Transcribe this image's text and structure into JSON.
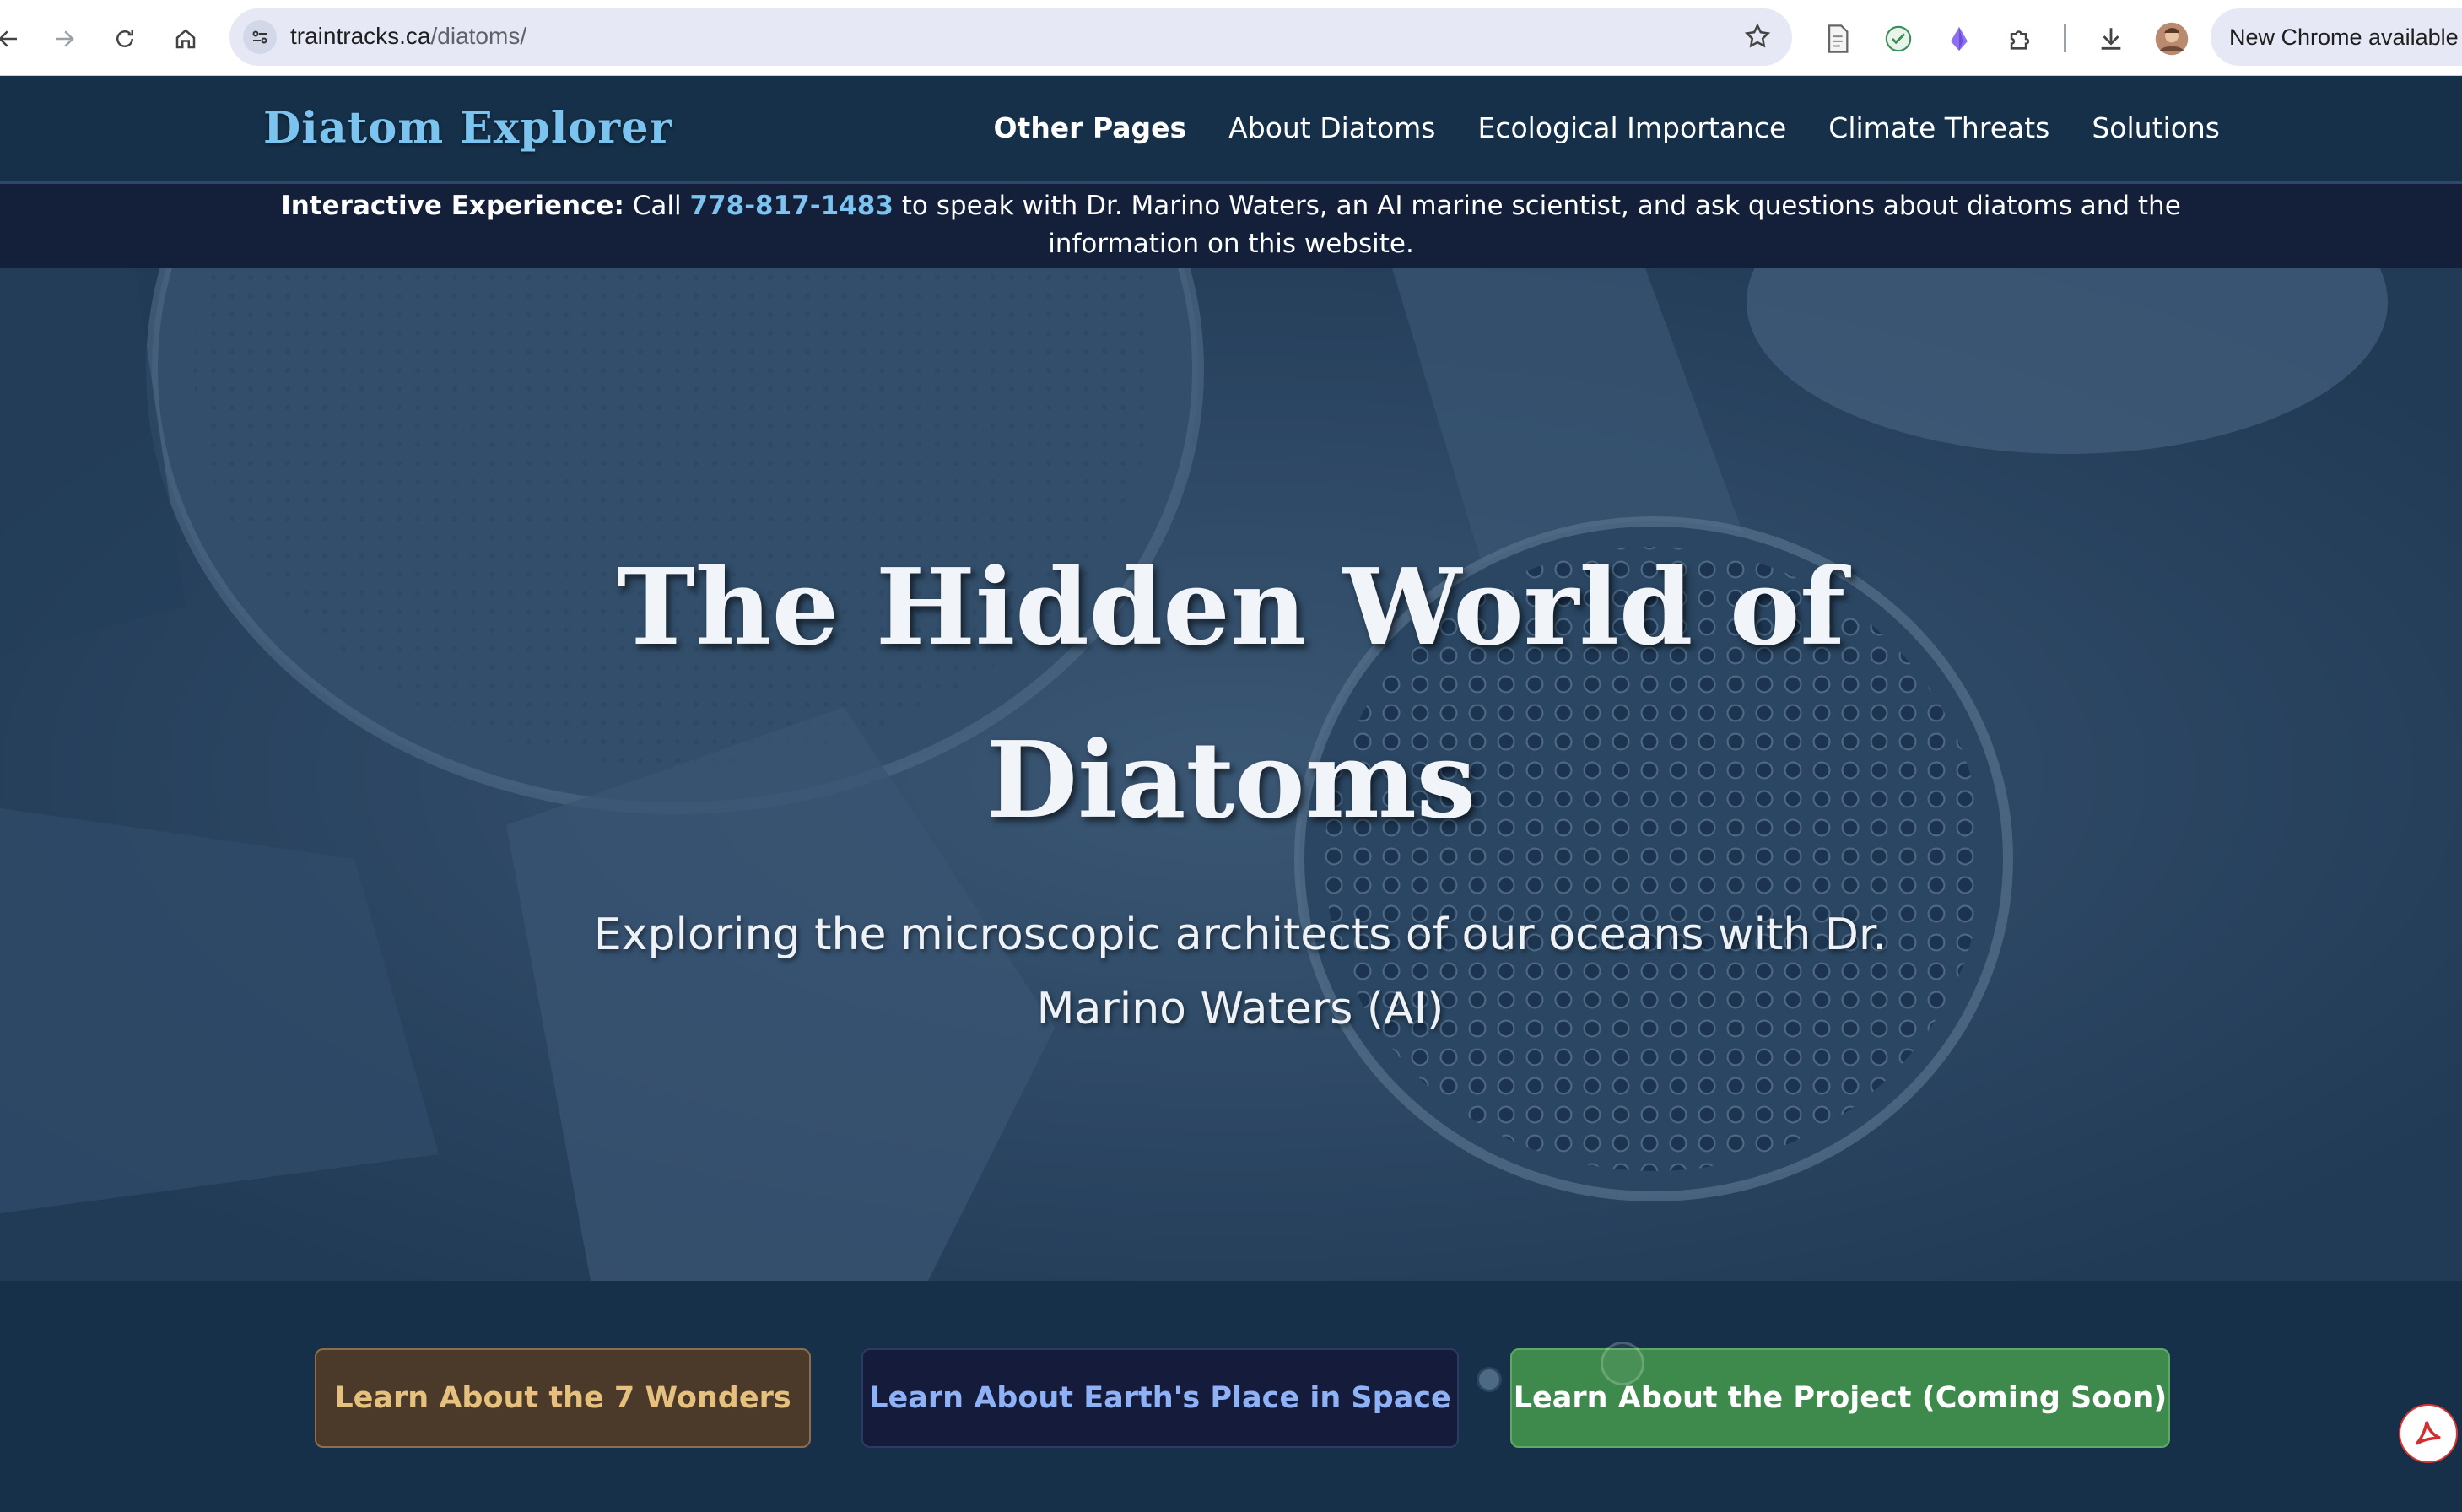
{
  "browser": {
    "url_host": "traintracks.ca",
    "url_path": "/diatoms/",
    "update_label": "New Chrome available",
    "icons": [
      "back-arrow-icon",
      "forward-arrow-icon",
      "reload-icon",
      "home-icon",
      "site-info-icon",
      "star-icon",
      "document-icon",
      "extension-green-icon",
      "extension-purple-icon",
      "puzzle-icon",
      "download-icon",
      "avatar"
    ]
  },
  "header": {
    "brand": "Diatom Explorer",
    "nav": [
      {
        "label": "Other Pages"
      },
      {
        "label": "About Diatoms"
      },
      {
        "label": "Ecological Importance"
      },
      {
        "label": "Climate Threats"
      },
      {
        "label": "Solutions"
      }
    ]
  },
  "banner": {
    "lead": "Interactive Experience:",
    "call": " Call ",
    "phone": "778-817-1483",
    "rest": " to speak with Dr. Marino Waters, an AI marine scientist, and ask questions about diatoms and the information on this website."
  },
  "hero": {
    "title_line1": "The Hidden World of",
    "title_line2": "Diatoms",
    "subtitle": "Exploring the microscopic architects of our oceans with Dr. Marino Waters (AI)"
  },
  "buttons": {
    "wonders": "Learn About the 7 Wonders",
    "space": "Learn About Earth's Place in Space",
    "project": "Learn About the Project (Coming Soon)"
  },
  "colors": {
    "page_bg": "#163049",
    "brand": "#7cc4f0",
    "banner_bg": "#14203a",
    "wonders_bg": "#4b3a2a",
    "space_bg": "#151b3a",
    "project_bg": "#3e8a4c"
  }
}
